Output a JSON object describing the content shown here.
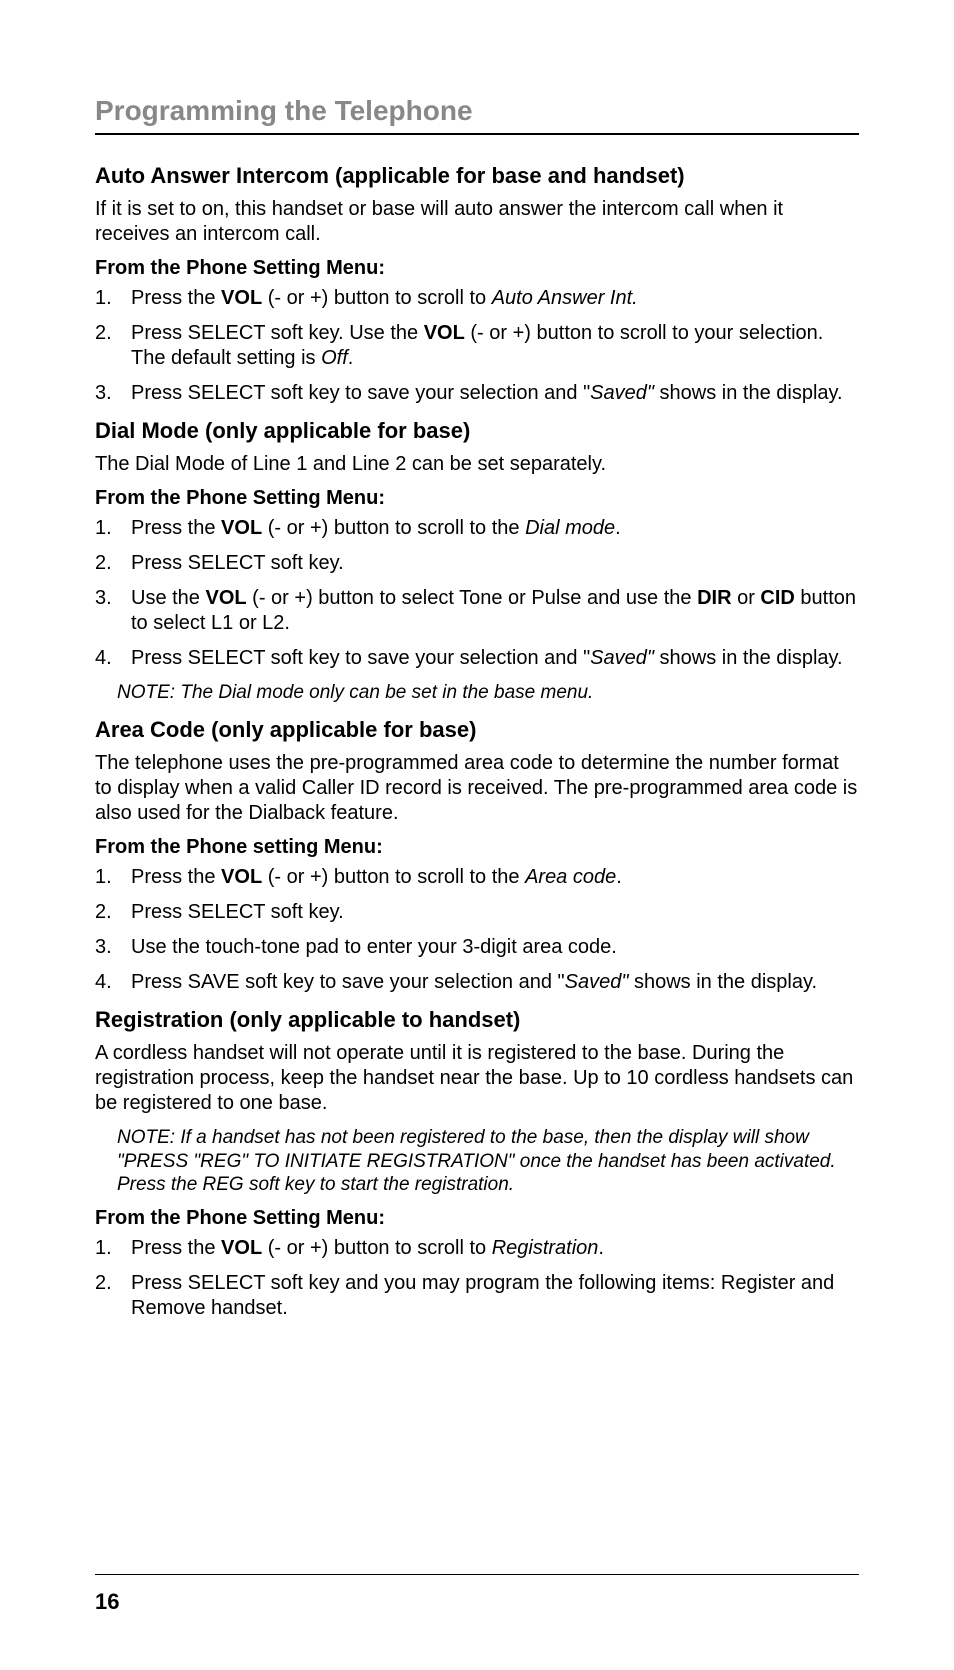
{
  "section_title": "Programming the Telephone",
  "page_number": "16",
  "sec1": {
    "title": "Auto Answer Intercom (applicable for base and handset)",
    "intro": "If it is set to on, this handset or base will auto answer the intercom call when it receives an intercom call.",
    "menu": "From the Phone Setting Menu:",
    "s1_a": "Press the ",
    "s1_b": "VOL",
    "s1_c": " (- or +) button to scroll to ",
    "s1_d": "Auto Answer Int.",
    "s2_a": "Press SELECT soft key. Use the ",
    "s2_b": "VOL",
    "s2_c": " (- or +) button to scroll to your selection. The default setting is ",
    "s2_d": "Off",
    "s2_e": ".",
    "s3_a": "Press SELECT soft key to save your selection and \"",
    "s3_b": "Saved\"",
    "s3_c": " shows in the display."
  },
  "sec2": {
    "title": "Dial Mode (only applicable for base)",
    "intro": "The Dial Mode of Line 1 and Line 2 can be set separately.",
    "menu": "From the Phone Setting Menu:",
    "s1_a": "Press the ",
    "s1_b": "VOL",
    "s1_c": " (- or +) button to scroll to the ",
    "s1_d": "Dial mode",
    "s1_e": ".",
    "s2": "Press SELECT soft key.",
    "s3_a": "Use the ",
    "s3_b": "VOL",
    "s3_c": " (- or +) button to select Tone or Pulse and use the ",
    "s3_d": "DIR",
    "s3_e": " or ",
    "s3_f": "CID",
    "s3_g": " button to select L1 or L2.",
    "s4_a": "Press SELECT soft key to save your selection and \"",
    "s4_b": "Saved\"",
    "s4_c": " shows in the display.",
    "note": "NOTE: The Dial mode only can be set in the base menu."
  },
  "sec3": {
    "title": "Area Code (only applicable for base)",
    "intro": "The telephone uses the pre-programmed area code to determine the number format to display when a valid Caller ID record is received. The pre-programmed area code is also used for the Dialback feature.",
    "menu": "From the Phone setting Menu:",
    "s1_a": "Press the ",
    "s1_b": "VOL",
    "s1_c": " (- or +) button to scroll to the ",
    "s1_d": "Area code",
    "s1_e": ".",
    "s2": "Press SELECT soft key.",
    "s3": "Use the touch-tone pad to enter your 3-digit area code.",
    "s4_a": "Press SAVE soft key to save your selection and \"",
    "s4_b": "Saved\"",
    "s4_c": " shows in the display."
  },
  "sec4": {
    "title": "Registration (only applicable to handset)",
    "intro": "A cordless handset will not operate until it is registered to the base. During the registration process, keep the handset near the base. Up to 10 cordless handsets can be registered to one base.",
    "note": "NOTE: If a handset has not been registered to the base, then the  display will show \"PRESS \"REG\" TO INITIATE REGISTRATION\" once the handset has been activated. Press the REG soft key to start the registration.",
    "menu": "From the Phone Setting Menu:",
    "s1_a": "Press the ",
    "s1_b": "VOL",
    "s1_c": " (- or +) button to scroll to ",
    "s1_d": "Registration",
    "s1_e": ".",
    "s2": "Press SELECT soft key and you may program the following items: Register and Remove handset."
  }
}
